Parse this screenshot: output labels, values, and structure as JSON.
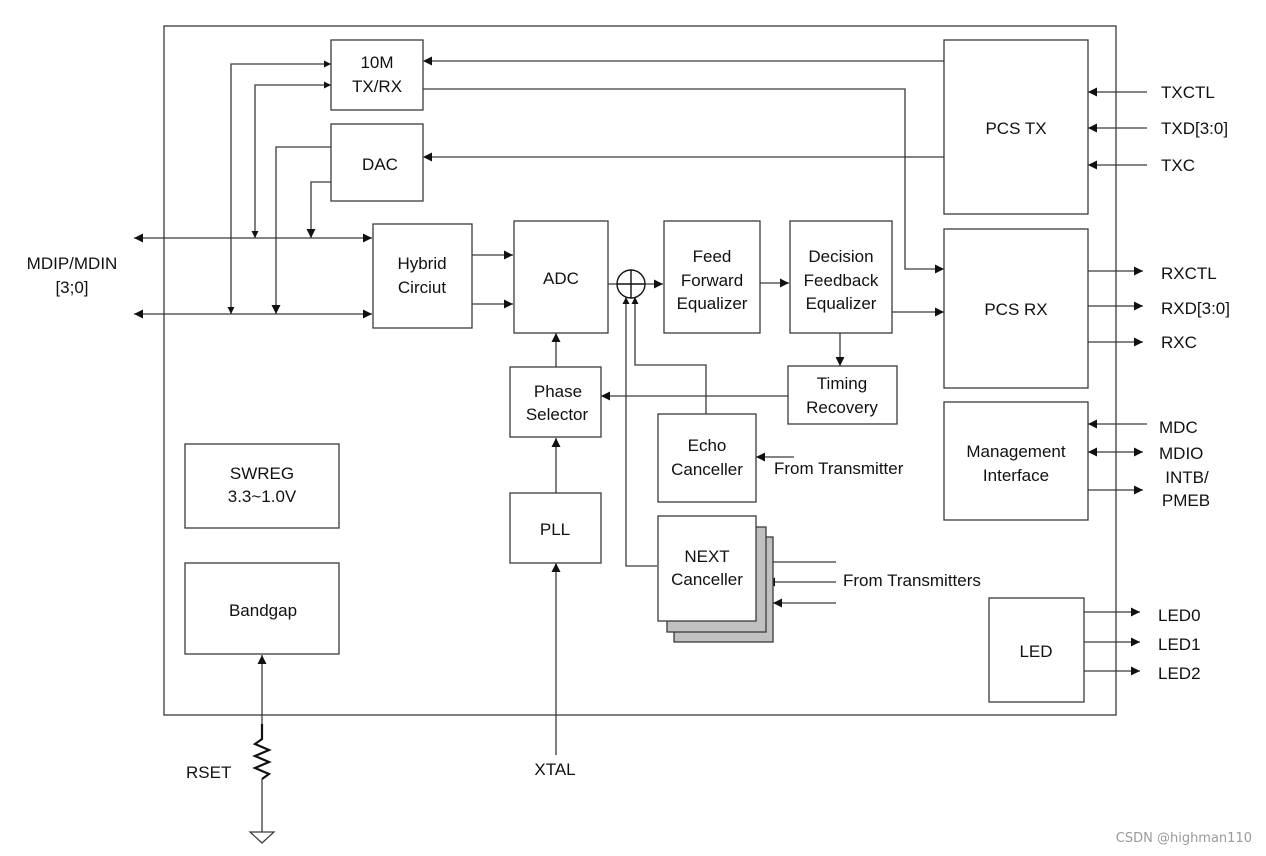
{
  "diagram": {
    "blocks": {
      "tx10m": [
        "10M",
        "TX/RX"
      ],
      "dac": [
        "DAC"
      ],
      "hybrid": [
        "Hybrid",
        "Circiut"
      ],
      "adc": [
        "ADC"
      ],
      "ffe": [
        "Feed",
        "Forward",
        "Equalizer"
      ],
      "dfe": [
        "Decision",
        "Feedback",
        "Equalizer"
      ],
      "pcs_tx": [
        "PCS TX"
      ],
      "pcs_rx": [
        "PCS RX"
      ],
      "phase_selector": [
        "Phase",
        "Selector"
      ],
      "timing_recovery": [
        "Timing",
        "Recovery"
      ],
      "echo_canceller": [
        "Echo",
        "Canceller"
      ],
      "next_canceller": [
        "NEXT",
        "Canceller"
      ],
      "pll": [
        "PLL"
      ],
      "swreg": [
        "SWREG",
        "3.3~1.0V"
      ],
      "bandgap": [
        "Bandgap"
      ],
      "mgmt": [
        "Management",
        "Interface"
      ],
      "led": [
        "LED"
      ]
    },
    "pins": {
      "mdi": [
        "MDIP/MDIN",
        "[3;0]"
      ],
      "txctl": "TXCTL",
      "txd": "TXD[3:0]",
      "txc": "TXC",
      "rxctl": "RXCTL",
      "rxd": "RXD[3:0]",
      "rxc": "RXC",
      "mdc": "MDC",
      "mdio": "MDIO",
      "intb": [
        "INTB/",
        "PMEB"
      ],
      "led0": "LED0",
      "led1": "LED1",
      "led2": "LED2",
      "rset": "RSET",
      "xtal": "XTAL"
    },
    "annotations": {
      "from_transmitter": "From Transmitter",
      "from_transmitters": "From Transmitters"
    },
    "watermark": "CSDN @highman110"
  }
}
